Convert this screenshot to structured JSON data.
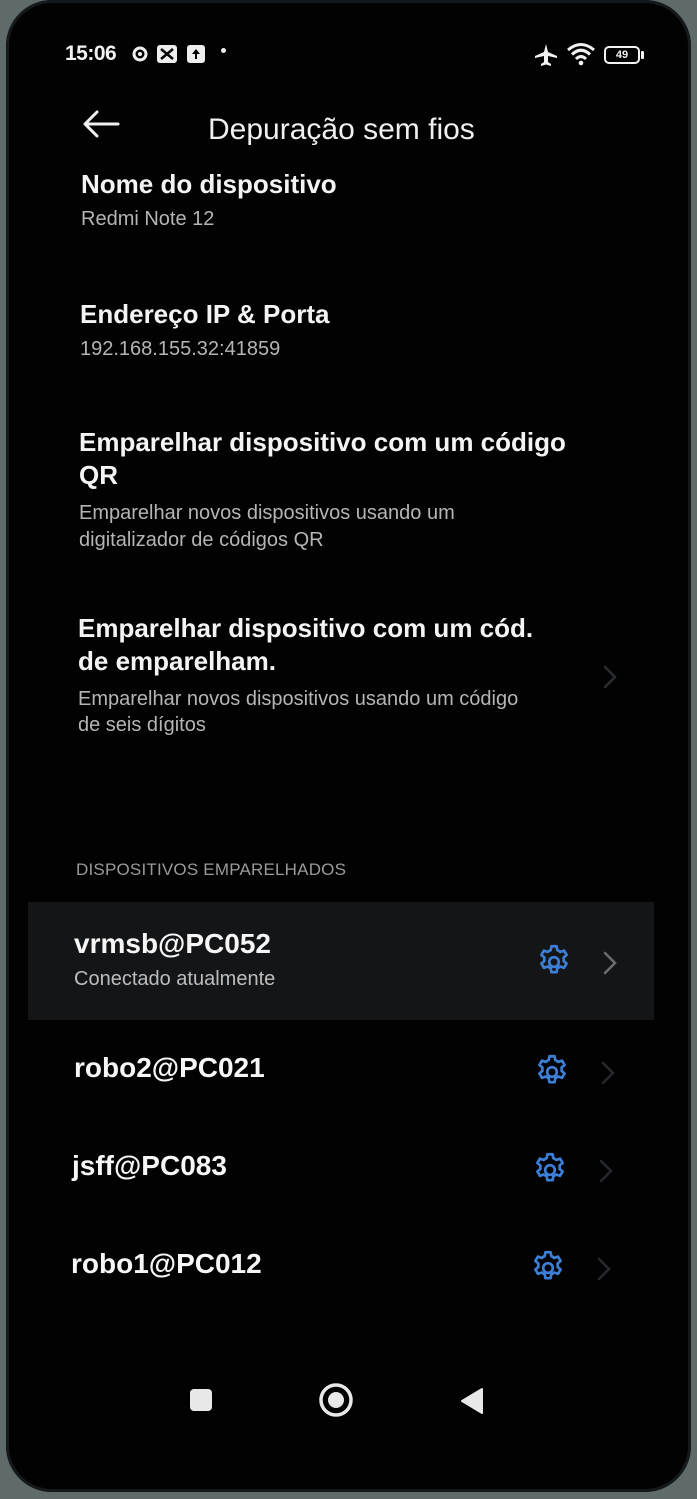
{
  "status_bar": {
    "time": "15:06",
    "battery": "49"
  },
  "header": {
    "title": "Depuração sem fios"
  },
  "items": [
    {
      "title": "Nome do dispositivo",
      "subtitle": "Redmi Note 12"
    },
    {
      "title": "Endereço IP & Porta",
      "subtitle": "192.168.155.32:41859"
    },
    {
      "title_line1": "Emparelhar dispositivo com um código",
      "title_line2": "QR",
      "subtitle_line1": "Emparelhar novos dispositivos usando um",
      "subtitle_line2": "digitalizador de códigos QR"
    },
    {
      "title_line1": "Emparelhar dispositivo com um cód.",
      "title_line2": "de emparelham.",
      "subtitle_line1": "Emparelhar novos dispositivos usando um código",
      "subtitle_line2": "de seis dígitos"
    }
  ],
  "paired": {
    "section_title": "DISPOSITIVOS EMPARELHADOS",
    "devices": [
      {
        "name": "vrmsb@PC052",
        "status": "Conectado atualmente"
      },
      {
        "name": "robo2@PC021"
      },
      {
        "name": "jsff@PC083"
      },
      {
        "name": "robo1@PC012"
      }
    ]
  },
  "colors": {
    "background": "#020203",
    "accent": "#3d7fd6",
    "text": "#f4f4f4",
    "secondary_text": "#b5b5b5"
  },
  "icons": [
    "back-arrow-icon",
    "gear-icon",
    "chevron-right-icon",
    "airplane-icon",
    "wifi-icon",
    "battery-icon",
    "nav-recents-icon",
    "nav-home-icon",
    "nav-back-icon"
  ]
}
